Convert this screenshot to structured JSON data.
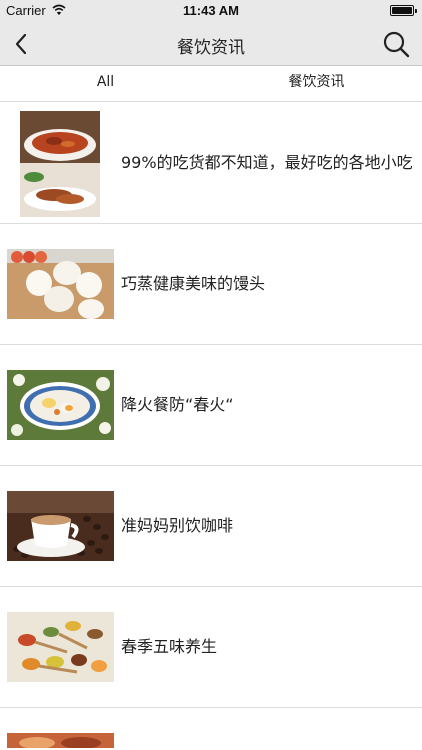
{
  "status": {
    "carrier": "Carrier",
    "time": "11:43 AM",
    "battery_level": 1.0
  },
  "nav": {
    "title": "餐饮资讯",
    "icons": [
      "back-chevron-icon",
      "search-icon"
    ]
  },
  "tabs": [
    {
      "label": "All"
    },
    {
      "label": "餐饮资讯"
    }
  ],
  "articles": [
    {
      "title": "99%的吃货都不知道，最好吃的各地小吃",
      "image": "stewed-meat-dish-photo"
    },
    {
      "title": "巧蒸健康美味的馒头",
      "image": "steamed-buns-photo"
    },
    {
      "title": "降火餐防“春火“",
      "image": "egg-soup-bowl-photo"
    },
    {
      "title": "准妈妈别饮咖啡",
      "image": "coffee-cup-beans-photo"
    },
    {
      "title": "春季五味养生",
      "image": "spice-spoons-photo"
    },
    {
      "title": "",
      "image": "food-photo-partial"
    }
  ],
  "colors": {
    "bar_bg": "#e9e9e9",
    "divider": "#dcdcdc",
    "text": "#222222"
  }
}
